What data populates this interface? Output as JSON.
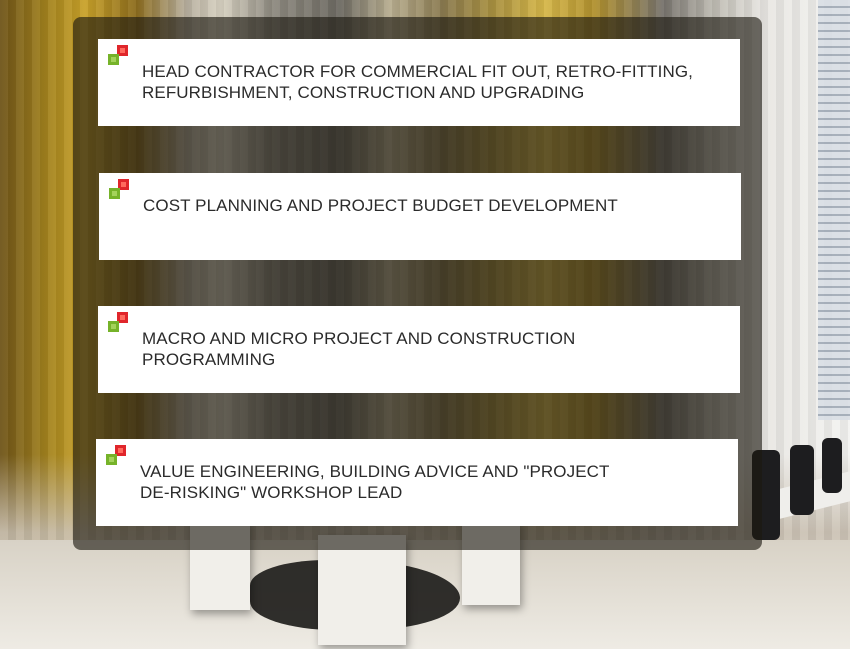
{
  "services": [
    {
      "text": "HEAD CONTRACTOR FOR COMMERCIAL FIT OUT, RETRO-FITTING, REFURBISHMENT, CONSTRUCTION AND UPGRADING"
    },
    {
      "text": "COST PLANNING AND PROJECT BUDGET DEVELOPMENT"
    },
    {
      "text": "MACRO AND MICRO PROJECT AND CONSTRUCTION PROGRAMMING"
    },
    {
      "text": "VALUE ENGINEERING, BUILDING ADVICE AND \"PROJECT DE-RISKING\" WORKSHOP LEAD"
    }
  ],
  "colors": {
    "icon_red": "#e0262b",
    "icon_green": "#76b32a",
    "card_background": "#ffffff",
    "panel_overlay": "rgba(28,24,16,0.62)"
  },
  "icons": {
    "bullet": "red-green-squares-icon"
  }
}
